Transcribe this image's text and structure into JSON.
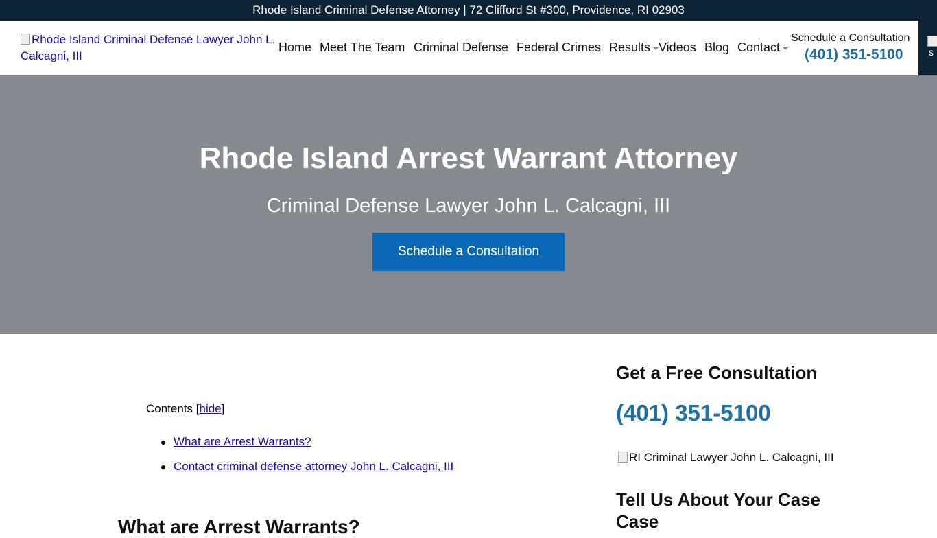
{
  "topbar": {
    "text": "Rhode Island Criminal Defense Attorney | 72 Clifford St #300, Providence, RI 02903"
  },
  "logo": {
    "alt": "Rhode Island Criminal Defense Lawyer John L. Calcagni, III"
  },
  "nav": {
    "items": [
      {
        "label": "Home",
        "dropdown": false
      },
      {
        "label": "Meet The Team",
        "dropdown": false
      },
      {
        "label": "Criminal Defense",
        "dropdown": false
      },
      {
        "label": "Federal Crimes",
        "dropdown": false
      },
      {
        "label": "Results",
        "dropdown": true
      },
      {
        "label": "Videos",
        "dropdown": false
      },
      {
        "label": "Blog",
        "dropdown": false
      },
      {
        "label": "Contact",
        "dropdown": true
      }
    ],
    "schedule_label": "Schedule a Consultation",
    "phone": "(401) 351-5100"
  },
  "side_tab": {
    "icon": "broken-image-icon",
    "text": "s"
  },
  "hero": {
    "title": "Rhode Island Arrest Warrant Attorney",
    "subtitle": "Criminal Defense Lawyer John L. Calcagni, III",
    "cta_label": "Schedule a Consultation"
  },
  "toc": {
    "label": "Contents",
    "toggle": "hide",
    "items": [
      "What are Arrest Warrants?",
      "Contact criminal defense attorney John L. Calcagni, III"
    ]
  },
  "main": {
    "section_heading": "What are Arrest Warrants?"
  },
  "aside": {
    "title": "Get a Free Consultation",
    "phone": "(401) 351-5100",
    "photo_alt": "RI Criminal Lawyer John L. Calcagni, III",
    "case_heading": "Tell Us About Your Case Case"
  },
  "colors": {
    "topbar": "#0c2436",
    "hero_bg": "#858a91",
    "cta": "#0b69b7",
    "phone": "#1d6fa5",
    "link": "#1a0dab"
  }
}
